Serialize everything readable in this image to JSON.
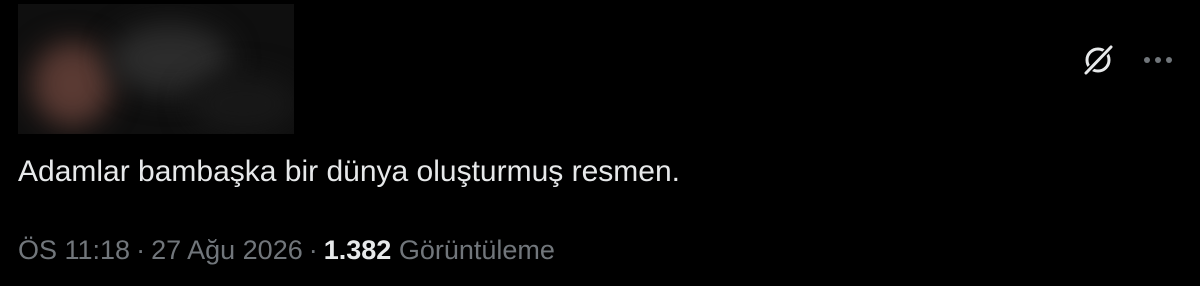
{
  "tweet": {
    "text": "Adamlar bambaşka bir dünya oluşturmuş resmen.",
    "time": "ÖS 11:18",
    "separator": "·",
    "date": "27 Ağu 2026",
    "views_count": "1.382",
    "views_label": "Görüntüleme"
  },
  "icons": {
    "grok": "grok-icon",
    "more": "more-icon"
  },
  "colors": {
    "background": "#000000",
    "text_primary": "#e7e9ea",
    "text_secondary": "#71767b"
  }
}
